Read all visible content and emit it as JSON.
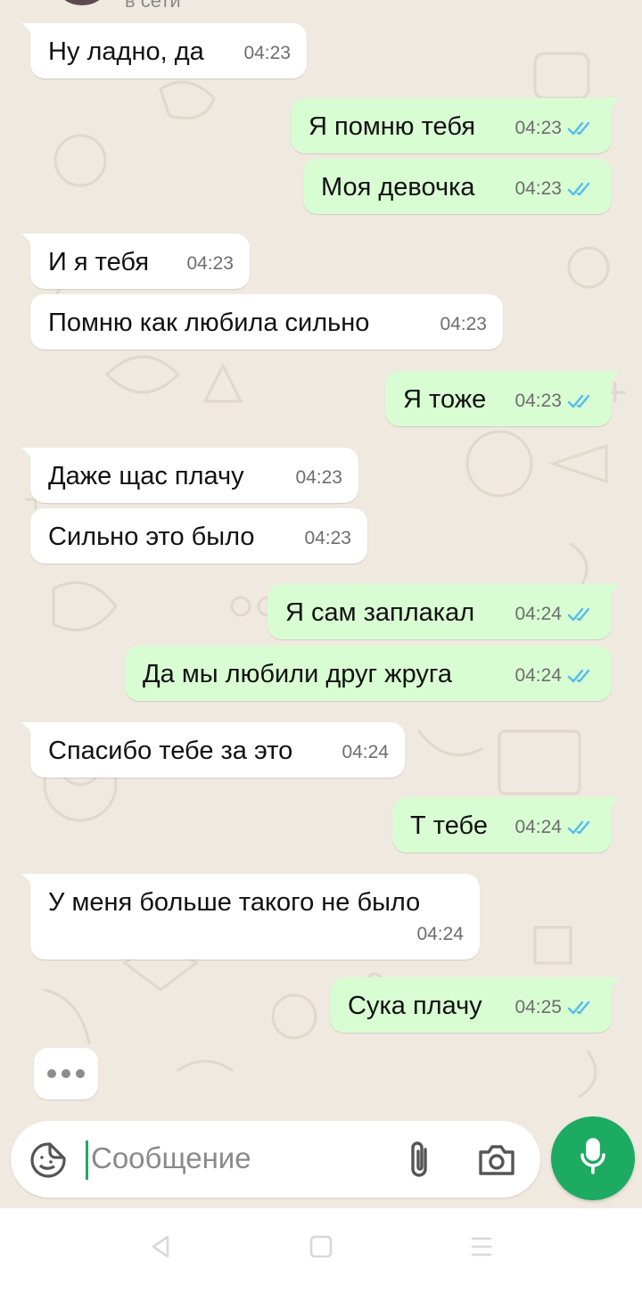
{
  "header": {
    "status_partial": "в сети"
  },
  "messages": [
    {
      "dir": "in",
      "text": "Ну ладно, да",
      "time": "04:23"
    },
    {
      "dir": "out",
      "text": "Я помню тебя",
      "time": "04:23"
    },
    {
      "dir": "out",
      "text": "Моя девочка",
      "time": "04:23"
    },
    {
      "dir": "in",
      "text": "И я тебя",
      "time": "04:23"
    },
    {
      "dir": "in",
      "text": "Помню как любила сильно",
      "time": "04:23"
    },
    {
      "dir": "out",
      "text": "Я тоже",
      "time": "04:23"
    },
    {
      "dir": "in",
      "text": "Даже щас плачу",
      "time": "04:23"
    },
    {
      "dir": "in",
      "text": "Сильно это было",
      "time": "04:23"
    },
    {
      "dir": "out",
      "text": "Я сам заплакал",
      "time": "04:24"
    },
    {
      "dir": "out",
      "text": "Да мы любили друг жруга",
      "time": "04:24"
    },
    {
      "dir": "in",
      "text": "Спасибо тебе за это",
      "time": "04:24"
    },
    {
      "dir": "out",
      "text": "Т тебе",
      "time": "04:24"
    },
    {
      "dir": "in",
      "text": "У меня больше такого не было",
      "time": "04:24"
    },
    {
      "dir": "out",
      "text": "Сука плачу",
      "time": "04:25"
    }
  ],
  "typing_indicator": "•••",
  "composer": {
    "placeholder": "Сообщение"
  },
  "icons": {
    "emoji": "sticker-smiley-icon",
    "attach": "paperclip-icon",
    "camera": "camera-icon",
    "mic": "microphone-icon",
    "read_receipt": "double-check-icon",
    "nav_back": "triangle-back-icon",
    "nav_home": "square-home-icon",
    "nav_recents": "menu-lines-icon"
  },
  "colors": {
    "outgoing_bubble": "#d9fdd3",
    "incoming_bubble": "#ffffff",
    "accent": "#1daa61",
    "read_ticks": "#53bdeb",
    "chat_background": "#efe9e0"
  }
}
